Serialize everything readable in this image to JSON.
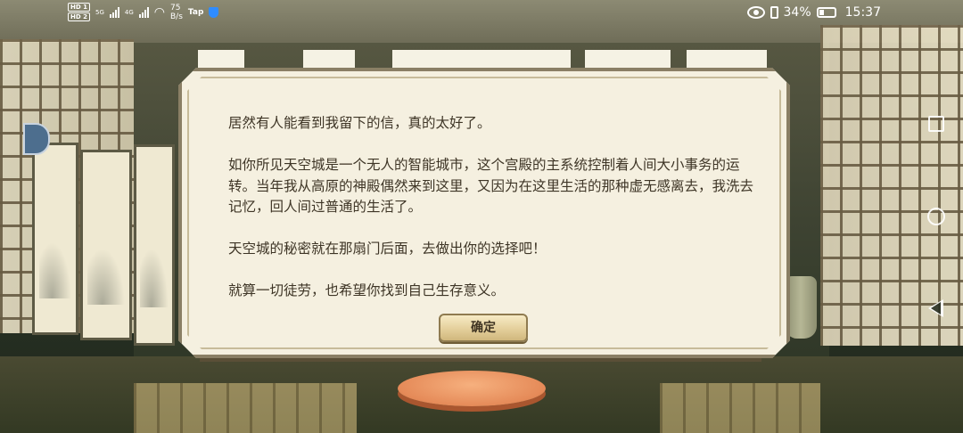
{
  "status_bar": {
    "hd_badges": [
      "HD 1",
      "HD 2"
    ],
    "network_primary": "5G",
    "network_secondary": "4G",
    "speed_value": "75",
    "speed_unit": "B/s",
    "app_tag": "Tap",
    "battery_level": 0.34,
    "battery_text": "34%",
    "time": "15:37"
  },
  "dialog": {
    "paragraphs": [
      "居然有人能看到我留下的信，真的太好了。",
      "如你所见天空城是一个无人的智能城市，这个宫殿的主系统控制着人间大小事务的运转。当年我从高原的神殿偶然来到这里，又因为在这里生活的那种虚无感离去，我洗去记忆，回人间过普通的生活了。",
      "天空城的秘密就在那扇门后面，去做出你的选择吧！",
      "就算一切徒劳，也希望你找到自己生存意义。"
    ],
    "confirm_label": "确定"
  },
  "navigation": {
    "icons": [
      "recent-apps-icon",
      "home-icon",
      "back-icon"
    ]
  },
  "colors": {
    "dialog_bg": "#f5f0e0",
    "dialog_border": "#8a7f65",
    "dialog_text": "#3e3526",
    "button_bg": "#e4cf9b",
    "cushion": "#e58a58"
  }
}
